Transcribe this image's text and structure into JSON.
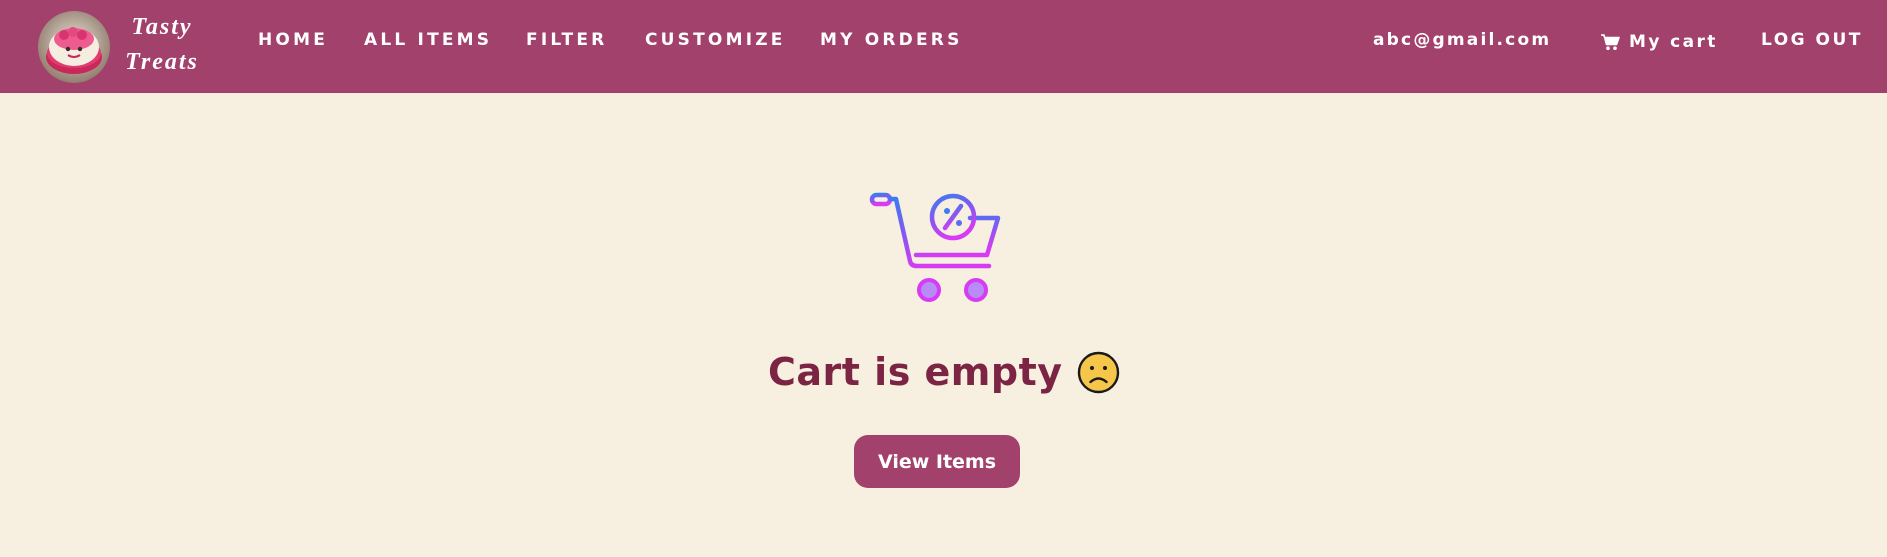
{
  "brand": {
    "line1": "Tasty",
    "line2": "Treats",
    "logo_icon": "cupcake-logo-icon"
  },
  "nav": {
    "home": "HOME",
    "all_items": "ALL ITEMS",
    "filter": "FILTER",
    "customize": "CUSTOMIZE",
    "my_orders": "MY ORDERS"
  },
  "user": {
    "email": "abc@gmail.com",
    "cart_label": "My cart",
    "cart_icon": "shopping-cart-icon",
    "logout": "LOG OUT"
  },
  "main": {
    "illustration_icon": "discount-cart-icon",
    "empty_message": "Cart is empty",
    "emoji_icon": "sad-face-icon",
    "view_button": "View Items"
  },
  "colors": {
    "navbar": "#a2426c",
    "background": "#f7efdf",
    "title": "#7b2443",
    "button": "#a2426c",
    "illustration_gradient_start": "#3d7bf0",
    "illustration_gradient_end": "#d63cf3"
  }
}
